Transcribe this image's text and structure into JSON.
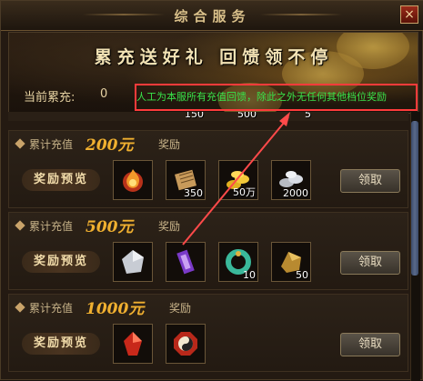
{
  "window": {
    "title": "综合服务",
    "close_icon": "×"
  },
  "banner": {
    "title": "累充送好礼 回馈领不停",
    "accumulated_label": "当前累充:",
    "accumulated_value": "0"
  },
  "annotation": {
    "text": "人工为本服所有充值回馈，除此之外无任何其他档位奖励",
    "box_color": "#ff3b3b",
    "text_color": "#39e34a",
    "arrow_color": "#ff4a4a"
  },
  "previous_tier_partial": {
    "quantities": [
      "150",
      "500",
      "5"
    ]
  },
  "tiers": [
    {
      "prefix": "累计充值",
      "amount": "200元",
      "suffix": "奖励",
      "preview_label": "奖励预览",
      "claim_label": "领取",
      "items": [
        {
          "icon": "flame-orb-icon",
          "qty": ""
        },
        {
          "icon": "scroll-icon",
          "qty": "350"
        },
        {
          "icon": "gold-coins-icon",
          "qty": "50万"
        },
        {
          "icon": "silver-ingots-icon",
          "qty": "2000"
        }
      ]
    },
    {
      "prefix": "累计充值",
      "amount": "500元",
      "suffix": "奖励",
      "preview_label": "奖励预览",
      "claim_label": "领取",
      "items": [
        {
          "icon": "silver-stone-icon",
          "qty": ""
        },
        {
          "icon": "purple-talisman-icon",
          "qty": ""
        },
        {
          "icon": "jade-ring-icon",
          "qty": "10"
        },
        {
          "icon": "gold-ore-icon",
          "qty": "50"
        }
      ]
    },
    {
      "prefix": "累计充值",
      "amount": "1000元",
      "suffix": "奖励",
      "preview_label": "奖励预览",
      "claim_label": "领取",
      "items": [
        {
          "icon": "red-crystal-icon",
          "qty": ""
        },
        {
          "icon": "taiji-octagon-icon",
          "qty": ""
        }
      ]
    }
  ],
  "colors": {
    "amount": "#f0b030",
    "gold_text": "#d9c08a",
    "panel": "#241a12"
  }
}
